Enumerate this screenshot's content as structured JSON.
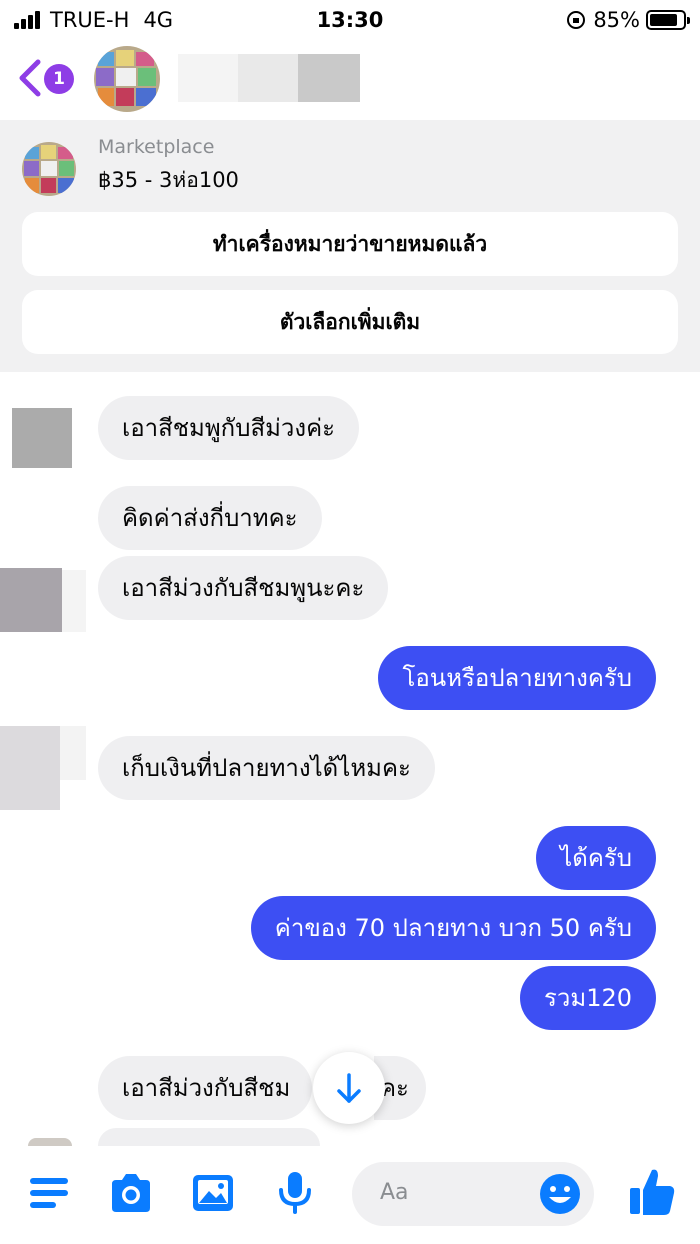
{
  "status_bar": {
    "carrier": "TRUE-H",
    "network": "4G",
    "time": "13:30",
    "battery": "85%",
    "battery_level": 0.85
  },
  "header": {
    "unread_count": "1",
    "back_icon": "chevron-left-icon"
  },
  "marketplace": {
    "source": "Marketplace",
    "title": "฿35 - 3ห่อ100",
    "mark_sold_label": "ทำเครื่องหมายว่าขายหมดแล้ว",
    "more_options_label": "ตัวเลือกเพิ่มเติม"
  },
  "messages": [
    {
      "direction": "incoming",
      "text": "เอาสีชมพูกับสีม่วงค่ะ"
    },
    {
      "direction": "incoming",
      "text": "คิดค่าส่งกี่บาทคะ"
    },
    {
      "direction": "incoming",
      "text": "เอาสีม่วงกับสีชมพูนะคะ"
    },
    {
      "direction": "outgoing",
      "text": "โอนหรือปลายทางครับ"
    },
    {
      "direction": "incoming",
      "text": "เก็บเงินที่ปลายทางได้ไหมคะ"
    },
    {
      "direction": "outgoing",
      "text": "ได้ครับ"
    },
    {
      "direction": "outgoing",
      "text": "ค่าของ 70 ปลายทาง บวก 50 ครับ"
    },
    {
      "direction": "outgoing",
      "text": "รวม120"
    },
    {
      "direction": "incoming",
      "text": "เอาสีม่วงกับสีชม"
    },
    {
      "direction": "incoming",
      "text": "คะ"
    }
  ],
  "composer": {
    "placeholder": "Aa",
    "icons": [
      "menu-icon",
      "camera-icon",
      "image-icon",
      "microphone-icon",
      "emoji-icon",
      "thumbs-up-icon"
    ]
  },
  "colors": {
    "accent": "#0a7cff",
    "outgoing_bubble": "#3d4ff3",
    "incoming_bubble": "#efeff1",
    "badge": "#8e3de6",
    "banner_bg": "#f1f1f2"
  }
}
